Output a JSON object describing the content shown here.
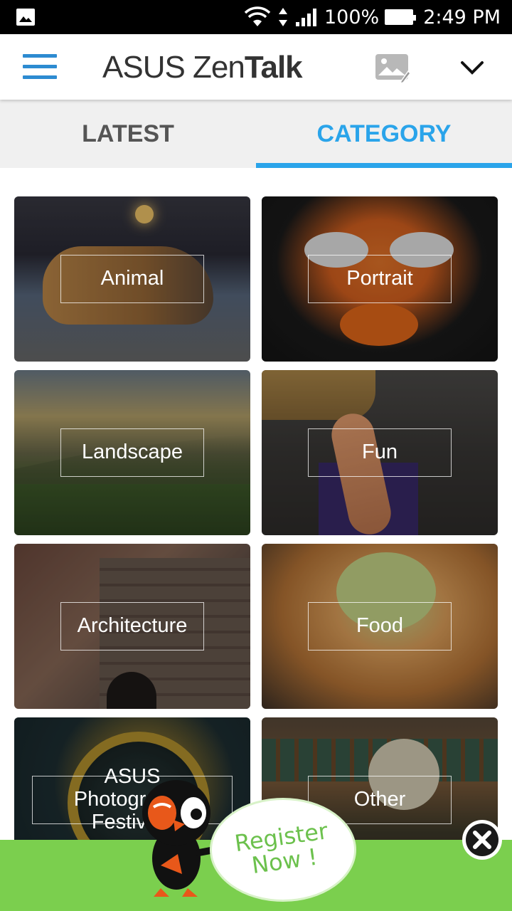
{
  "status_bar": {
    "battery": "100%",
    "time": "2:49 PM"
  },
  "app_bar": {
    "logo_light": "ASUS Zen",
    "logo_bold": "Talk"
  },
  "tabs": [
    {
      "label": "LATEST",
      "active": false
    },
    {
      "label": "CATEGORY",
      "active": true
    }
  ],
  "categories": [
    {
      "label": "Animal"
    },
    {
      "label": "Portrait"
    },
    {
      "label": "Landscape"
    },
    {
      "label": "Fun"
    },
    {
      "label": "Architecture"
    },
    {
      "label": "Food"
    },
    {
      "label": "ASUS\nPhotography Festivals"
    },
    {
      "label": "Other"
    }
  ],
  "ad": {
    "text": "Register\nNow !"
  },
  "colors": {
    "accent": "#2aa4ea",
    "menu_blue": "#2d8bd1",
    "ad_green": "#7bcf4e"
  }
}
